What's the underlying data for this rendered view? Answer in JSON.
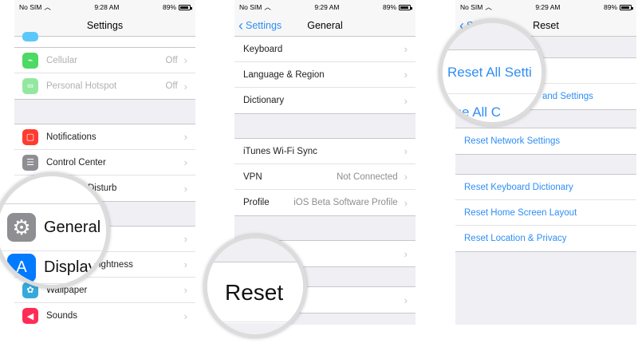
{
  "status_bars": [
    {
      "carrier": "No SIM",
      "time": "9:28 AM",
      "battery": "89%"
    },
    {
      "carrier": "No SIM",
      "time": "9:29 AM",
      "battery": "89%"
    },
    {
      "carrier": "No SIM",
      "time": "9:29 AM",
      "battery": "89%"
    }
  ],
  "screen1": {
    "title": "Settings",
    "group1": [
      {
        "label": "Cellular",
        "value": "Off",
        "icon": "antenna-icon",
        "color": "#4cd964"
      },
      {
        "label": "Personal Hotspot",
        "value": "Off",
        "icon": "hotspot-icon",
        "color": "#4cd964"
      }
    ],
    "group2": [
      {
        "label": "Notifications",
        "icon": "notifications-icon",
        "color": "#ff3b30"
      },
      {
        "label": "Control Center",
        "icon": "control-center-icon",
        "color": "#8e8e93"
      },
      {
        "label": "Disturb",
        "icon": "moon-icon",
        "color": "#5856d6"
      }
    ],
    "group3": [
      {
        "label": "",
        "icon": "gear-icon",
        "color": "#8e8e93"
      },
      {
        "label": "ightness",
        "icon": "display-icon",
        "color": "#007aff"
      },
      {
        "label": "Wallpaper",
        "icon": "wallpaper-icon",
        "color": "#34aadc"
      },
      {
        "label": "Sounds",
        "icon": "sounds-icon",
        "color": "#ff2d55"
      }
    ],
    "magnifier": {
      "general": "General",
      "display": "Display"
    }
  },
  "screen2": {
    "back_label": "Settings",
    "title": "General",
    "group1": [
      {
        "label": "Keyboard"
      },
      {
        "label": "Language & Region"
      },
      {
        "label": "Dictionary"
      }
    ],
    "group2": [
      {
        "label": "iTunes Wi-Fi Sync",
        "value": ""
      },
      {
        "label": "VPN",
        "value": "Not Connected"
      },
      {
        "label": "Profile",
        "value": "iOS Beta Software Profile"
      }
    ],
    "magnifier": {
      "reset": "Reset"
    }
  },
  "screen3": {
    "back_label": "S",
    "title": "Reset",
    "row1": "Reset All Settings",
    "row2": "and Settings",
    "row3": "Reset Network Settings",
    "group2": [
      {
        "label": "Reset Keyboard Dictionary"
      },
      {
        "label": "Reset Home Screen Layout"
      },
      {
        "label": "Reset Location & Privacy"
      }
    ],
    "magnifier": {
      "line1": "Reset All Setti",
      "line2": "ase All C"
    }
  },
  "colors": {
    "accent": "#2f8ef5",
    "background": "#efeff4"
  }
}
